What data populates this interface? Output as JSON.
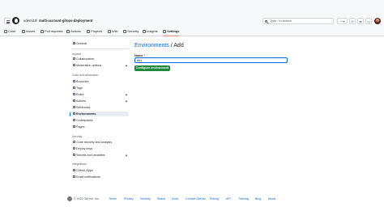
{
  "header": {
    "owner": "udemi10",
    "separator": "/",
    "repo": "multi-account-gitops-deployment",
    "search_placeholder": "Type / to search",
    "new_button": "+ ▾",
    "tabs": [
      {
        "label": "Code",
        "icon": "code-icon"
      },
      {
        "label": "Issues",
        "icon": "issue-icon"
      },
      {
        "label": "Pull requests",
        "icon": "pull-request-icon"
      },
      {
        "label": "Actions",
        "icon": "play-icon"
      },
      {
        "label": "Projects",
        "icon": "table-icon"
      },
      {
        "label": "Wiki",
        "icon": "book-icon"
      },
      {
        "label": "Security",
        "icon": "shield-icon"
      },
      {
        "label": "Insights",
        "icon": "graph-icon"
      },
      {
        "label": "Settings",
        "icon": "gear-icon",
        "active": true
      }
    ]
  },
  "sidebar": {
    "general": "General",
    "access_heading": "Access",
    "collaborators": "Collaborators",
    "moderation": "Moderation options",
    "code_heading": "Code and automation",
    "branches": "Branches",
    "tags": "Tags",
    "rules": "Rules",
    "actions": "Actions",
    "webhooks": "Webhooks",
    "environments": "Environments",
    "codespaces": "Codespaces",
    "pages": "Pages",
    "security_heading": "Security",
    "code_security": "Code security and analysis",
    "deploy_keys": "Deploy keys",
    "secrets": "Secrets and variables",
    "integrations_heading": "Integrations",
    "github_apps": "GitHub Apps",
    "email_notifications": "Email notifications"
  },
  "main": {
    "title_link": "Environments",
    "title_sep": "/",
    "title_rest": "Add",
    "name_label": "Name",
    "required_mark": "*",
    "name_value": "dev",
    "configure_button": "Configure environment"
  },
  "footer": {
    "copyright": "© 2023 GitHub, Inc.",
    "links": [
      "Terms",
      "Privacy",
      "Security",
      "Status",
      "Docs",
      "Contact GitHub",
      "Pricing",
      "API",
      "Training",
      "Blog",
      "About"
    ]
  },
  "colors": {
    "accent": "#0969da",
    "primary_button": "#1f883d",
    "active_tab_underline": "#fd8c73"
  }
}
